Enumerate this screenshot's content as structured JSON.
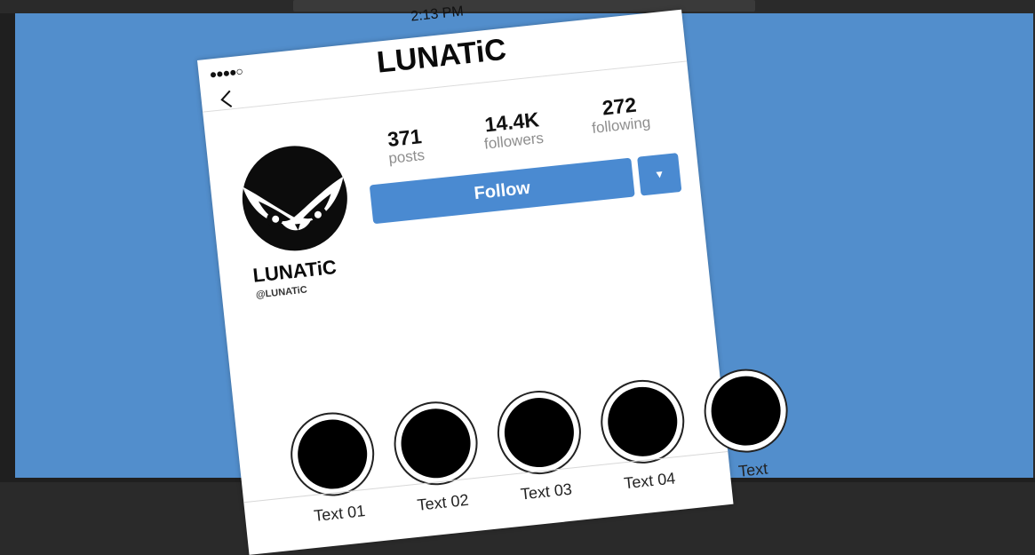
{
  "status_bar": {
    "signal": "●●●●○",
    "time": "2:13 PM",
    "more": "•••"
  },
  "nav": {
    "title": "LUNATiC"
  },
  "profile": {
    "stats": [
      {
        "value": "371",
        "label": "posts"
      },
      {
        "value": "14.4K",
        "label": "followers"
      },
      {
        "value": "272",
        "label": "following"
      }
    ],
    "follow_label": "Follow",
    "dropdown_glyph": "▼",
    "name": "LUNATiC",
    "handle": "@LUNATiC"
  },
  "stories": [
    {
      "label": "Text 01"
    },
    {
      "label": "Text 02"
    },
    {
      "label": "Text 03"
    },
    {
      "label": "Text 04"
    },
    {
      "label": "Text"
    }
  ],
  "colors": {
    "background": "#528ecc",
    "button": "#4a8ad1"
  }
}
